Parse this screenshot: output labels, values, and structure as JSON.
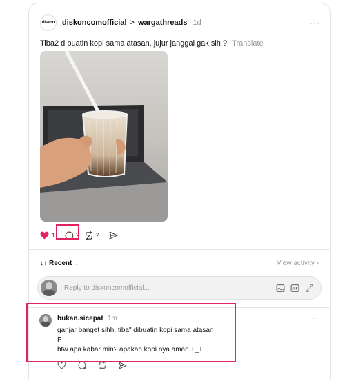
{
  "post": {
    "avatar_logo_text": "diskon",
    "username": "diskoncomofficial",
    "separator": ">",
    "topic": "wargathreads",
    "time": "1d",
    "more": "···",
    "text": "Tiba2 d buatin kopi sama atasan, jujur janggal gak sih ?",
    "translate": "Translate",
    "like_count": "1",
    "comment_count": "2",
    "repost_count": "2"
  },
  "sort": {
    "label": "Recent",
    "arrows": "↓↑",
    "view_activity": "View activity ›"
  },
  "reply": {
    "placeholder": "Reply to diskoncomofficial..."
  },
  "comment": {
    "username": "bukan.sicepat",
    "time": "1m",
    "more": "···",
    "lines": [
      "ganjar banget sihh, tiba\" dibuatin kopi sama atasan",
      "P",
      "btw apa kabar min? apakah kopi nya aman T_T"
    ]
  },
  "colors": {
    "like_red": "#e0245e",
    "highlight": "#e0245e",
    "muted": "#999999"
  },
  "icons": {
    "like": "heart-filled-icon",
    "comment": "speech-bubble-icon",
    "repost": "repost-arrows-icon",
    "share": "send-icon",
    "photo": "image-icon",
    "gif": "gif-icon",
    "expand": "expand-icon"
  }
}
